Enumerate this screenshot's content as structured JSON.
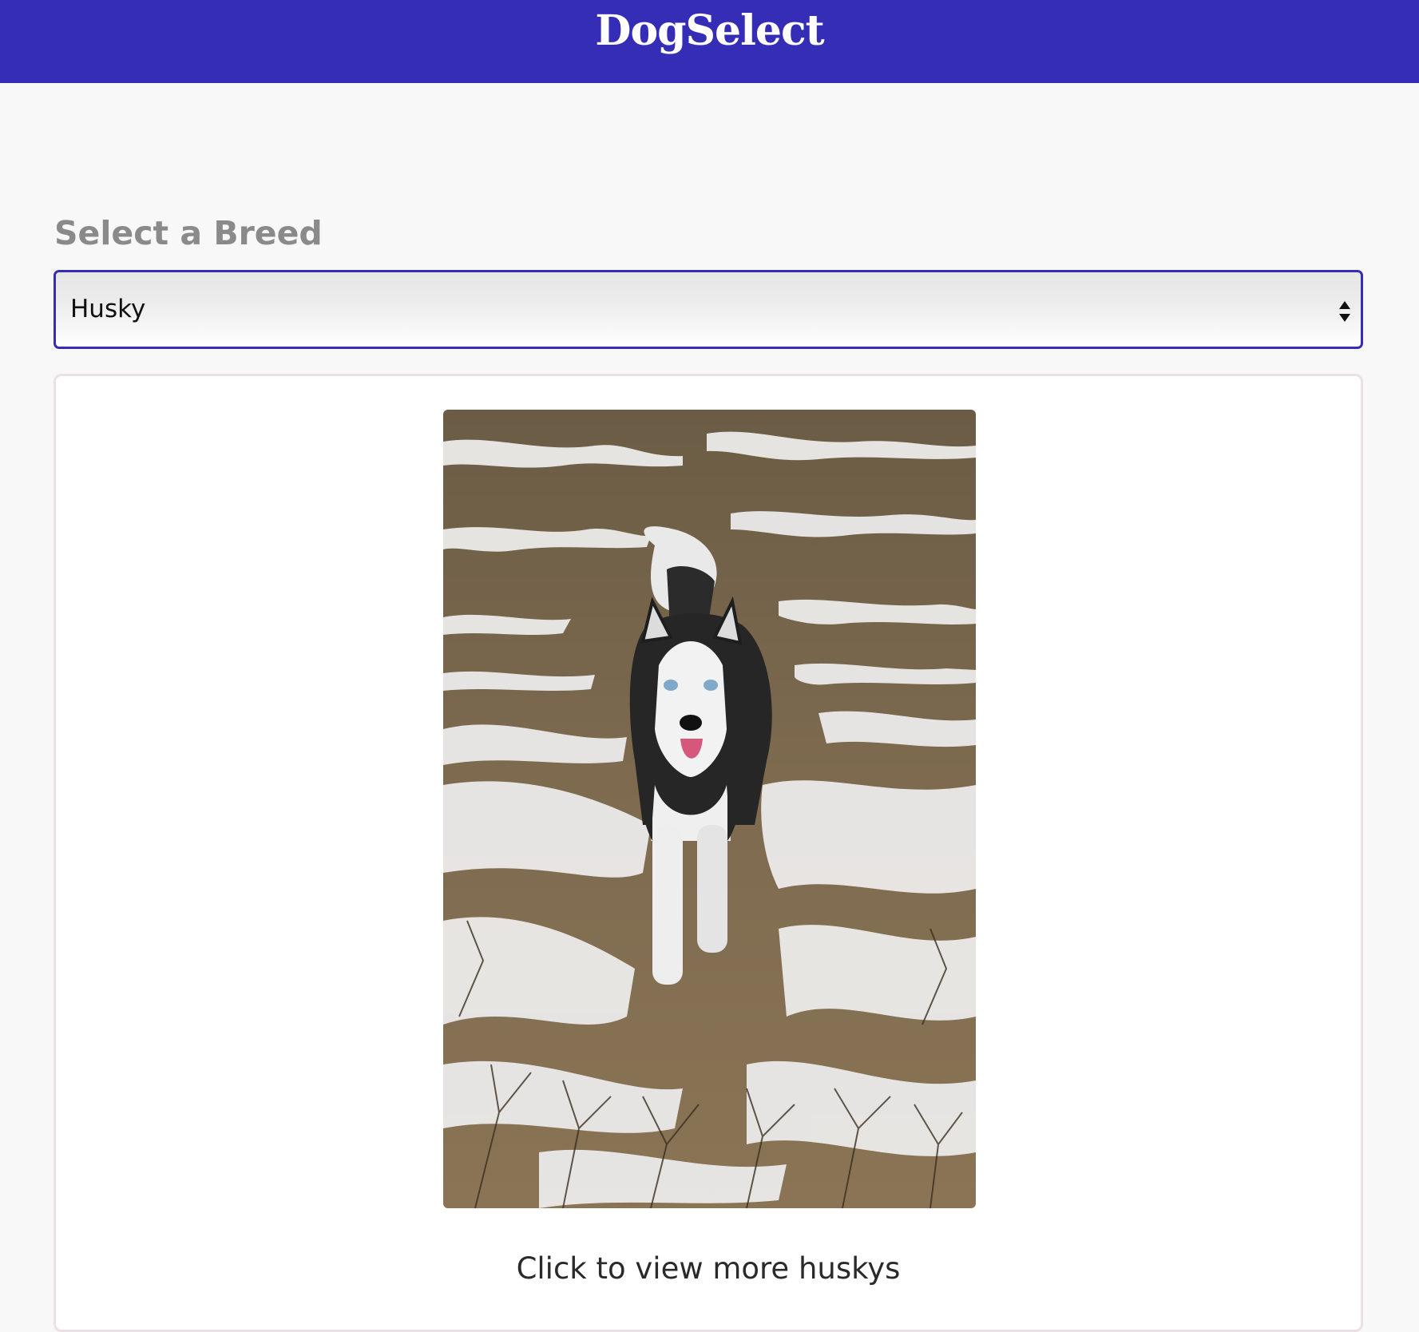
{
  "header": {
    "title": "DogSelect",
    "background_color": "#352db5"
  },
  "breed_selector": {
    "label": "Select a Breed",
    "selected_value": "Husky",
    "icon": "sort-arrows-icon",
    "accent_color": "#352db5"
  },
  "gallery": {
    "image": "husky-in-snow-photo",
    "caption": "Click to view more huskys"
  }
}
